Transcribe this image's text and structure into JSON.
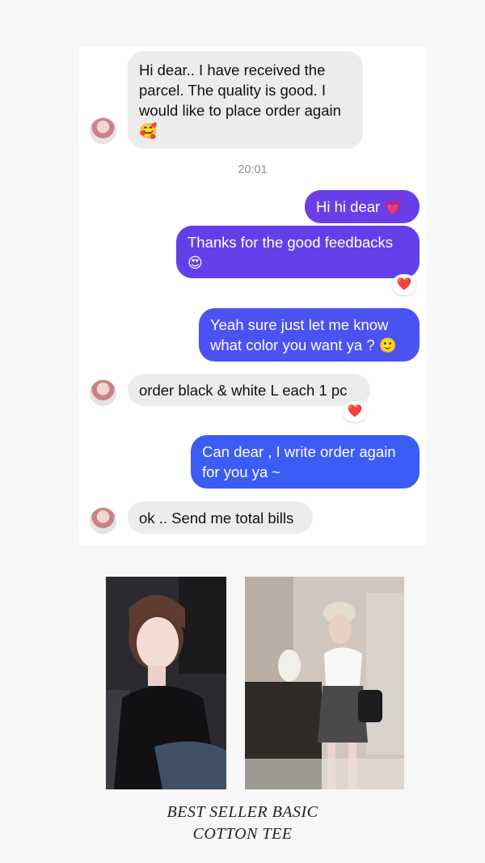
{
  "messages": [
    {
      "text": "Hi dear.. I have received the parcel. The quality is good. I would like to place order again",
      "emoji": "🥰"
    },
    {
      "text": "Hi hi dear",
      "emoji": "💗"
    },
    {
      "text": "Thanks for the good feedbacks",
      "emoji": "😍"
    },
    {
      "text": "Yeah sure just let me know what color you want ya ?",
      "emoji": "🙂"
    },
    {
      "text": "order black & white L each 1 pc"
    },
    {
      "text": "Can dear , I write order again for you ya ~"
    },
    {
      "text": "ok .. Send me total bills"
    }
  ],
  "timestamp": "20:01",
  "reaction_icon": "heart-icon",
  "reaction_glyph": "❤️",
  "caption": {
    "line1": "BEST SELLER BASIC",
    "line2": "COTTON TEE"
  },
  "colors": {
    "outgoing_bubble_top": "#6640e8",
    "outgoing_bubble_bottom": "#3a5df5",
    "incoming_bubble": "#ececec"
  }
}
